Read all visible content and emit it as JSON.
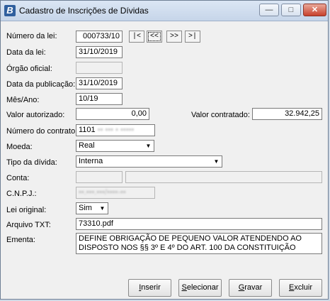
{
  "window": {
    "title": "Cadastro de Inscrições de Dívidas",
    "app_icon_letter": "B",
    "minimize": "—",
    "maximize": "□",
    "close": "✕"
  },
  "nav": {
    "first": "|<",
    "prev": "<<",
    "next": ">>",
    "last": ">|"
  },
  "fields": {
    "numero_lei": {
      "label": "Número da lei:",
      "value": "000733/10"
    },
    "data_lei": {
      "label": "Data da lei:",
      "value": "31/10/2019"
    },
    "orgao_oficial": {
      "label": "Órgão oficial:",
      "value": ""
    },
    "data_publicacao": {
      "label": "Data da publicação:",
      "value": "31/10/2019"
    },
    "mes_ano": {
      "label": "Mês/Ano:",
      "value": "10/19"
    },
    "valor_autorizado": {
      "label": "Valor autorizado:",
      "value": "0,00"
    },
    "valor_contratado": {
      "label": "Valor contratado:",
      "value": "32.942,25"
    },
    "numero_contrato": {
      "label": "Número do contrato:",
      "value": "1101",
      "value_blurred": "•• ••• • •••••"
    },
    "moeda": {
      "label": "Moeda:",
      "value": "Real"
    },
    "tipo_divida": {
      "label": "Tipo da dívida:",
      "value": "Interna"
    },
    "conta": {
      "label": "Conta:",
      "value": ""
    },
    "cnpj": {
      "label": "C.N.P.J.:",
      "value_blurred": "••.•••.•••/••••-••"
    },
    "lei_original": {
      "label": "Lei original:",
      "value": "Sim"
    },
    "arquivo_txt": {
      "label": "Arquivo TXT:",
      "value": "73310.pdf"
    },
    "ementa": {
      "label": "Ementa:",
      "line1": "DEFINE OBRIGAÇÃO DE PEQUENO VALOR ATENDENDO AO",
      "line2": "DISPOSTO NOS §§ 3º E 4º DO ART. 100 DA CONSTITUIÇÃO"
    }
  },
  "buttons": {
    "inserir": "Inserir",
    "selecionar": "Selecionar",
    "gravar": "Gravar",
    "excluir": "Excluir"
  }
}
